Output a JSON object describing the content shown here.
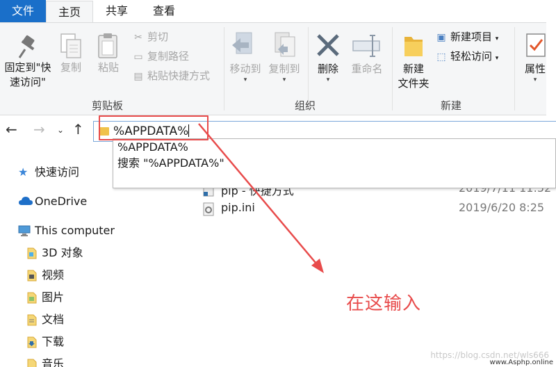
{
  "tabs": {
    "file": "文件",
    "home": "主页",
    "share": "共享",
    "view": "查看"
  },
  "ribbon": {
    "clipboard": {
      "label": "剪贴板",
      "pin_line1": "固定到\"快",
      "pin_line2": "速访问\"",
      "copy": "复制",
      "paste": "粘贴",
      "cut": "剪切",
      "copy_path": "复制路径",
      "paste_shortcut": "粘贴快捷方式"
    },
    "organize": {
      "label": "组织",
      "move_to": "移动到",
      "copy_to": "复制到",
      "delete": "删除",
      "rename": "重命名"
    },
    "new": {
      "label": "新建",
      "new_folder_line1": "新建",
      "new_folder_line2": "文件夹",
      "new_item": "新建项目",
      "easy_access": "轻松访问"
    },
    "open": {
      "properties": "属性"
    }
  },
  "address_bar": {
    "value": "%APPDATA%"
  },
  "autocomplete": {
    "items": [
      "%APPDATA%",
      "搜索 \"%APPDATA%\""
    ]
  },
  "sidebar": {
    "quick_access": "快速访问",
    "onedrive": "OneDrive",
    "this_computer": "This computer",
    "items": [
      "3D 对象",
      "视频",
      "图片",
      "文档",
      "下载",
      "音乐"
    ]
  },
  "files": [
    {
      "name": "pip - 快捷方式",
      "date": "2019/7/11 11:52"
    },
    {
      "name": "pip.ini",
      "date": "2019/6/20 8:25"
    }
  ],
  "annotation": "在这输入",
  "watermark": "https://blog.csdn.net/wls666",
  "watermark2": "www.Asphp.online",
  "colors": {
    "accent": "#1a6fc9",
    "annotation_red": "#e84b4b",
    "ribbon_bg": "#f5f6f7"
  }
}
